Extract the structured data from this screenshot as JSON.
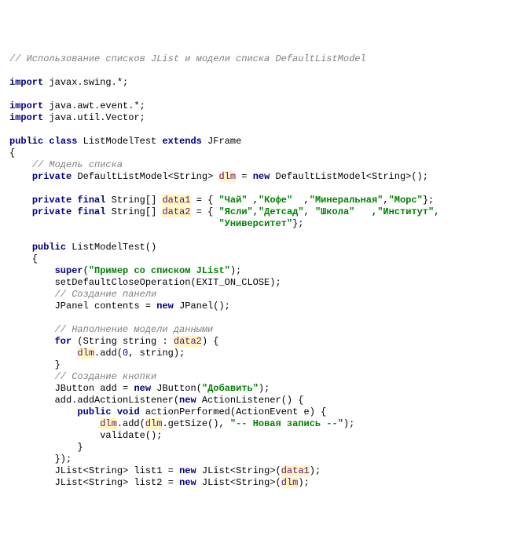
{
  "c": {
    "headerComment": "// Использование списков JList и модели списка DefaultListModel",
    "modelComment": "// Модель списка",
    "panelComment": "// Создание панели",
    "fillComment": "// Наполнение модели данными",
    "buttonComment": "// Создание кнопки"
  },
  "kw": {
    "import": "import",
    "public": "public",
    "class": "class",
    "extends": "extends",
    "private": "private",
    "final": "final",
    "new": "new",
    "for": "for",
    "super": "super",
    "void": "void"
  },
  "pkg": {
    "swing": "javax.swing.*;",
    "awtevent": "java.awt.event.*;",
    "utilVector": "java.util.Vector;"
  },
  "names": {
    "className": "ListModelTest",
    "superClass": "JFrame",
    "DefaultListModel": "DefaultListModel",
    "StringType": "String",
    "dlm": "dlm",
    "data1": "data1",
    "data2": "data2",
    "JPanel": "JPanel",
    "contents": "contents",
    "string": "string",
    "JButton": "JButton",
    "add": "add",
    "ActionListener": "ActionListener",
    "actionPerformed": "actionPerformed",
    "ActionEvent": "ActionEvent",
    "e": "e",
    "validate": "validate",
    "JList": "JList",
    "list1": "list1",
    "list2": "list2",
    "setDefaultCloseOperation": "setDefaultCloseOperation",
    "EXIT_ON_CLOSE": "EXIT_ON_CLOSE",
    "addActionListener": "addActionListener",
    "getSize": "getSize"
  },
  "str": {
    "tea": "\"Чай\"",
    "coffee": "\"Кофе\"",
    "mineral": "\"Минеральная\"",
    "mors": "\"Морс\"",
    "yasli": "\"Ясли\"",
    "detsad": "\"Детсад\"",
    "shkola": "\"Школа\"",
    "institut": "\"Институт\"",
    "universitet": "\"Университет\"",
    "title": "\"Пример со списком JList\"",
    "dobavit": "\"Добавить\"",
    "novaya": "\"-- Новая запись --\""
  },
  "num": {
    "zero": "0"
  }
}
